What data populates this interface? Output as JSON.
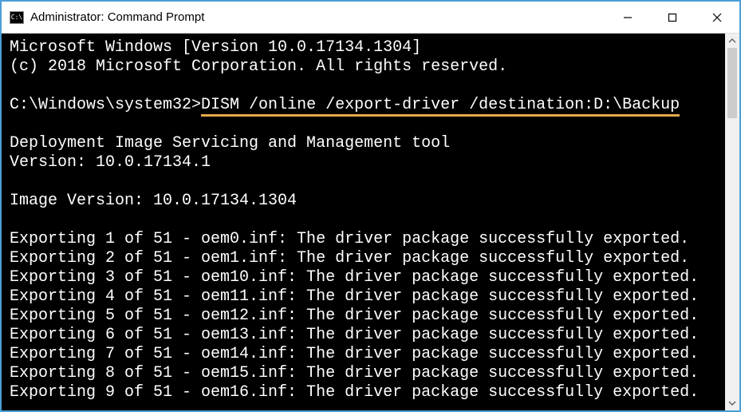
{
  "title": "Administrator: Command Prompt",
  "icon_glyph": "C:\\",
  "window_buttons": {
    "minimize": "–",
    "maximize": "▢",
    "close": "✕"
  },
  "terminal": {
    "header_line1": "Microsoft Windows [Version 10.0.17134.1304]",
    "header_line2": "(c) 2018 Microsoft Corporation. All rights reserved.",
    "blank": "",
    "prompt_prefix": "C:\\Windows\\system32>",
    "command": "DISM /online /export-driver /destination:D:\\Backup",
    "tool_line1": "Deployment Image Servicing and Management tool",
    "tool_line2": "Version: 10.0.17134.1",
    "image_version": "Image Version: 10.0.17134.1304",
    "export_lines": [
      "Exporting 1 of 51 - oem0.inf: The driver package successfully exported.",
      "Exporting 2 of 51 - oem1.inf: The driver package successfully exported.",
      "Exporting 3 of 51 - oem10.inf: The driver package successfully exported.",
      "Exporting 4 of 51 - oem11.inf: The driver package successfully exported.",
      "Exporting 5 of 51 - oem12.inf: The driver package successfully exported.",
      "Exporting 6 of 51 - oem13.inf: The driver package successfully exported.",
      "Exporting 7 of 51 - oem14.inf: The driver package successfully exported.",
      "Exporting 8 of 51 - oem15.inf: The driver package successfully exported.",
      "Exporting 9 of 51 - oem16.inf: The driver package successfully exported."
    ]
  }
}
